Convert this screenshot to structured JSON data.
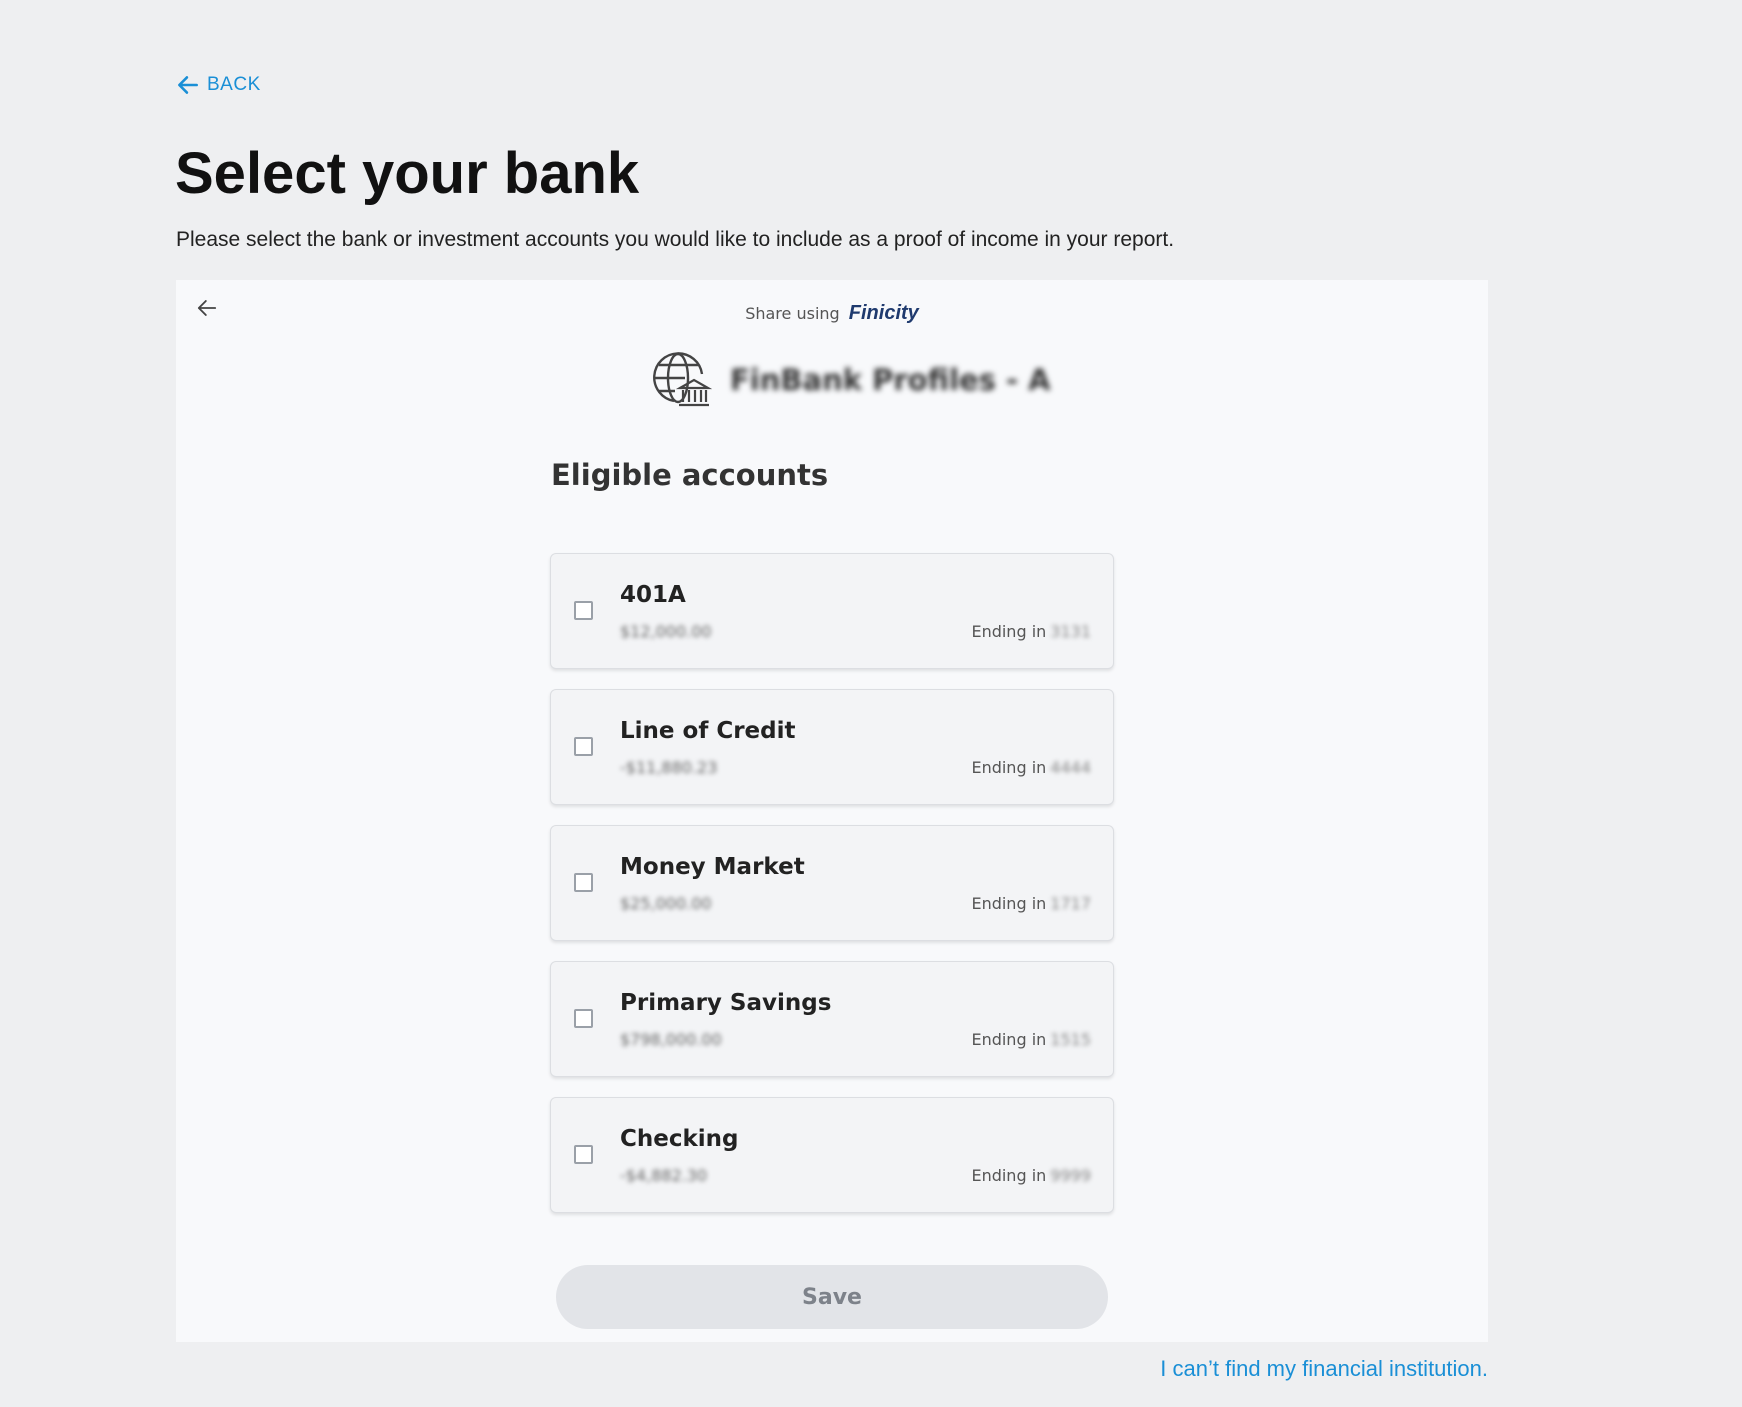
{
  "header": {
    "back_label": "BACK",
    "title": "Select your bank",
    "subtitle": "Please select the bank or investment accounts you would like to include as a proof of income in your report."
  },
  "widget": {
    "share_using": "Share using",
    "brand": "Finicity",
    "institution_name": "FinBank Profiles - A",
    "section_title": "Eligible accounts",
    "ending_label": "Ending in",
    "accounts": [
      {
        "name": "401A",
        "balance": "$12,000.00",
        "ending": "3131",
        "checked": false
      },
      {
        "name": "Line of Credit",
        "balance": "-$11,880.23",
        "ending": "4444",
        "checked": false
      },
      {
        "name": "Money Market",
        "balance": "$25,000.00",
        "ending": "1717",
        "checked": false
      },
      {
        "name": "Primary Savings",
        "balance": "$798,000.00",
        "ending": "1515",
        "checked": false
      },
      {
        "name": "Checking",
        "balance": "-$4,882.30",
        "ending": "9999",
        "checked": false
      }
    ],
    "save_label": "Save"
  },
  "footer": {
    "cant_find_label": "I can’t find my financial institution."
  },
  "colors": {
    "accent": "#1a8fd6",
    "brand": "#1f3a6e",
    "background": "#eeeff1",
    "panel": "#f8f9fb"
  }
}
